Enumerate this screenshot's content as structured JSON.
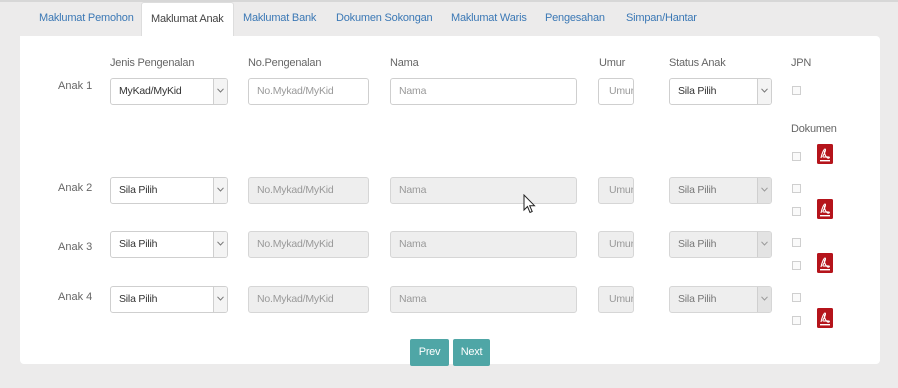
{
  "tabs": [
    {
      "label": "Maklumat Pemohon"
    },
    {
      "label": "Maklumat Anak"
    },
    {
      "label": "Maklumat Bank"
    },
    {
      "label": "Dokumen Sokongan"
    },
    {
      "label": "Maklumat Waris"
    },
    {
      "label": "Pengesahan"
    },
    {
      "label": "Simpan/Hantar"
    }
  ],
  "active_tab": "Maklumat Anak",
  "headers": {
    "jenis": "Jenis Pengenalan",
    "no": "No.Pengenalan",
    "nama": "Nama",
    "umur": "Umur",
    "status": "Status Anak",
    "jpn": "JPN",
    "dokumen": "Dokumen"
  },
  "placeholders": {
    "no": "No.Mykad/MyKid",
    "nama": "Nama",
    "umur": "Umur"
  },
  "rows": [
    {
      "label": "Anak 1",
      "jenis": "MyKad/MyKid",
      "status": "Sila Pilih",
      "disabled": false
    },
    {
      "label": "Anak 2",
      "jenis": "Sila Pilih",
      "status": "Sila Pilih",
      "disabled": true
    },
    {
      "label": "Anak 3",
      "jenis": "Sila Pilih",
      "status": "Sila Pilih",
      "disabled": true
    },
    {
      "label": "Anak 4",
      "jenis": "Sila Pilih",
      "status": "Sila Pilih",
      "disabled": true
    }
  ],
  "buttons": {
    "prev": "Prev",
    "next": "Next"
  },
  "colors": {
    "accent": "#4fa6a6",
    "tab_link": "#3b78b5",
    "pdf_red": "#b5141b"
  },
  "icons": {
    "document": "pdf-icon",
    "dropdown": "chevron-down-icon",
    "pointer": "mouse-pointer-icon"
  }
}
